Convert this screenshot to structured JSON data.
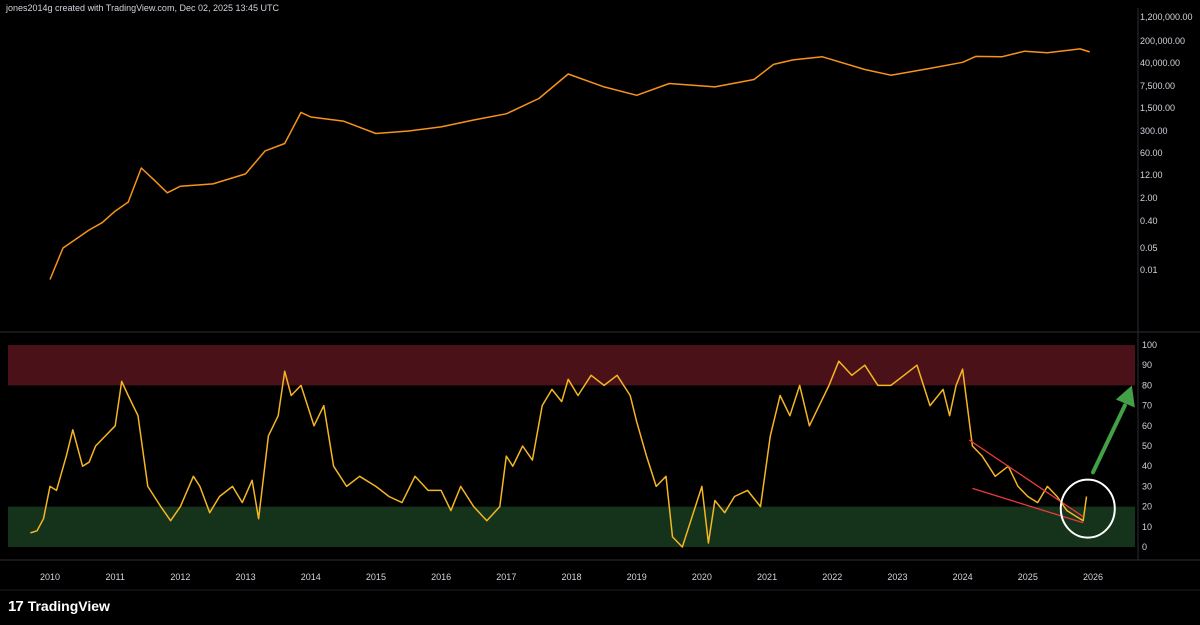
{
  "header": {
    "text": "jones2014g created with TradingView.com, Dec 02, 2025 13:45 UTC"
  },
  "logo": {
    "mark": "17",
    "text": "TradingView"
  },
  "colors": {
    "price_line": "#f7931a",
    "rsi_line": "#f5b623",
    "overbought_zone": "#4a1218",
    "oversold_zone": "#15331b",
    "trend_lines": "#e8393f",
    "arrow": "#43a047",
    "circle": "#ffffff",
    "background": "#000000"
  },
  "chart_data": [
    {
      "type": "line",
      "title": "",
      "yscale": "log",
      "y_ticks": [
        "1,200,000.00",
        "200,000.00",
        "40,000.00",
        "7,500.00",
        "1,500.00",
        "300.00",
        "60.00",
        "12.00",
        "2.00",
        "0.40",
        "0.05",
        "0.01"
      ],
      "x": [
        2010.0,
        2010.2,
        2010.4,
        2010.6,
        2010.8,
        2011.0,
        2011.2,
        2011.4,
        2011.6,
        2011.8,
        2012.0,
        2012.5,
        2013.0,
        2013.3,
        2013.6,
        2013.85,
        2014.0,
        2014.5,
        2015.0,
        2015.5,
        2016.0,
        2016.5,
        2017.0,
        2017.5,
        2017.95,
        2018.5,
        2019.0,
        2019.5,
        2020.2,
        2020.8,
        2021.1,
        2021.4,
        2021.85,
        2022.5,
        2022.9,
        2023.5,
        2024.0,
        2024.2,
        2024.6,
        2024.95,
        2025.3,
        2025.8,
        2025.95
      ],
      "y": [
        0.005,
        0.05,
        0.1,
        0.2,
        0.35,
        0.8,
        1.5,
        20,
        8,
        3,
        5,
        6,
        13,
        70,
        120,
        1100,
        800,
        600,
        250,
        300,
        400,
        650,
        1000,
        3000,
        18000,
        7000,
        3800,
        9000,
        7000,
        12000,
        36000,
        50000,
        63000,
        25000,
        16500,
        27000,
        42000,
        65000,
        63000,
        95000,
        85000,
        112000,
        90000
      ]
    },
    {
      "type": "line",
      "title": "",
      "ylim": [
        0,
        100
      ],
      "y_ticks": [
        "100",
        "90",
        "80",
        "70",
        "60",
        "50",
        "40",
        "30",
        "20",
        "10",
        "0"
      ],
      "x_ticks": [
        "2010",
        "2011",
        "2012",
        "2013",
        "2014",
        "2015",
        "2016",
        "2017",
        "2018",
        "2019",
        "2020",
        "2021",
        "2022",
        "2023",
        "2024",
        "2025",
        "2026"
      ],
      "bands": [
        {
          "from": 80,
          "to": 100
        },
        {
          "from": 0,
          "to": 20
        }
      ],
      "x": [
        2009.7,
        2009.8,
        2009.9,
        2010.0,
        2010.1,
        2010.25,
        2010.35,
        2010.5,
        2010.6,
        2010.7,
        2010.85,
        2011.0,
        2011.1,
        2011.2,
        2011.35,
        2011.5,
        2011.7,
        2011.85,
        2012.0,
        2012.2,
        2012.3,
        2012.45,
        2012.6,
        2012.8,
        2012.95,
        2013.1,
        2013.2,
        2013.35,
        2013.5,
        2013.6,
        2013.7,
        2013.85,
        2014.05,
        2014.2,
        2014.35,
        2014.55,
        2014.75,
        2015.0,
        2015.2,
        2015.4,
        2015.6,
        2015.8,
        2016.0,
        2016.15,
        2016.3,
        2016.5,
        2016.7,
        2016.9,
        2017.0,
        2017.1,
        2017.25,
        2017.4,
        2017.55,
        2017.7,
        2017.85,
        2017.95,
        2018.1,
        2018.3,
        2018.5,
        2018.7,
        2018.9,
        2019.0,
        2019.15,
        2019.3,
        2019.45,
        2019.55,
        2019.7,
        2019.85,
        2020.0,
        2020.1,
        2020.2,
        2020.35,
        2020.5,
        2020.7,
        2020.9,
        2021.05,
        2021.2,
        2021.35,
        2021.5,
        2021.65,
        2021.8,
        2021.95,
        2022.1,
        2022.3,
        2022.5,
        2022.7,
        2022.9,
        2023.1,
        2023.3,
        2023.5,
        2023.7,
        2023.8,
        2023.9,
        2024.0,
        2024.15,
        2024.3,
        2024.5,
        2024.7,
        2024.85,
        2025.0,
        2025.15,
        2025.3,
        2025.45,
        2025.6,
        2025.75,
        2025.85,
        2025.9
      ],
      "y": [
        7,
        8,
        14,
        30,
        28,
        45,
        58,
        40,
        42,
        50,
        55,
        60,
        82,
        75,
        65,
        30,
        20,
        13,
        20,
        35,
        30,
        17,
        25,
        30,
        22,
        33,
        14,
        55,
        65,
        87,
        75,
        80,
        60,
        70,
        40,
        30,
        35,
        30,
        25,
        22,
        35,
        28,
        28,
        18,
        30,
        20,
        13,
        20,
        45,
        40,
        50,
        43,
        70,
        78,
        72,
        83,
        75,
        85,
        80,
        85,
        75,
        62,
        45,
        30,
        35,
        5,
        0,
        15,
        30,
        2,
        23,
        17,
        25,
        28,
        20,
        55,
        75,
        65,
        80,
        60,
        70,
        80,
        92,
        85,
        90,
        80,
        80,
        85,
        90,
        70,
        78,
        65,
        80,
        88,
        50,
        45,
        35,
        40,
        30,
        25,
        22,
        30,
        25,
        18,
        15,
        13,
        25
      ]
    }
  ]
}
